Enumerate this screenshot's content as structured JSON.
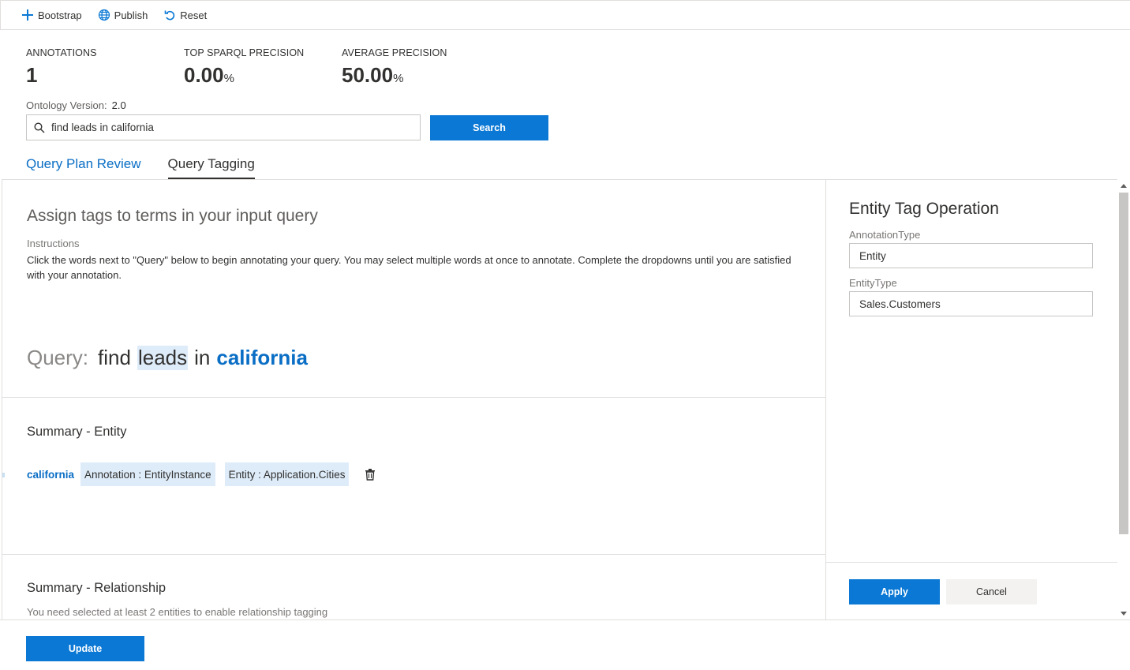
{
  "toolbar": {
    "bootstrap": "Bootstrap",
    "publish": "Publish",
    "reset": "Reset"
  },
  "metrics": [
    {
      "label": "ANNOTATIONS",
      "value": "1",
      "unit": ""
    },
    {
      "label": "TOP SPARQL PRECISION",
      "value": "0.00",
      "unit": "%"
    },
    {
      "label": "AVERAGE PRECISION",
      "value": "50.00",
      "unit": "%"
    }
  ],
  "ontology": {
    "label": "Ontology Version:",
    "value": "2.0"
  },
  "search": {
    "value": "find leads in california",
    "button": "Search"
  },
  "tabs": [
    {
      "label": "Query Plan Review",
      "active": false
    },
    {
      "label": "Query Tagging",
      "active": true
    }
  ],
  "tagging": {
    "title": "Assign tags to terms in your input query",
    "instructions_heading": "Instructions",
    "instructions": "Click the words next to \"Query\" below to begin annotating your query. You may select multiple words at once to annotate. Complete the dropdowns until you are satisfied with your annotation.",
    "query_label": "Query:",
    "query_words": [
      "find",
      "leads",
      "in",
      "california"
    ]
  },
  "summary_entity": {
    "title": "Summary - Entity",
    "items": [
      {
        "term": "california",
        "annotation": "Annotation : EntityInstance",
        "entity": "Entity : Application.Cities"
      }
    ]
  },
  "summary_relationship": {
    "title": "Summary - Relationship",
    "note": "You need selected at least 2 entities to enable relationship tagging"
  },
  "entity_panel": {
    "title": "Entity Tag Operation",
    "annotation_type_label": "AnnotationType",
    "annotation_type_value": "Entity",
    "entity_type_label": "EntityType",
    "entity_type_value": "Sales.Customers",
    "apply": "Apply",
    "cancel": "Cancel"
  },
  "footer": {
    "update": "Update"
  },
  "colors": {
    "accent": "#0a78d4",
    "link": "#0a6ec5",
    "highlight": "#deecf9"
  }
}
